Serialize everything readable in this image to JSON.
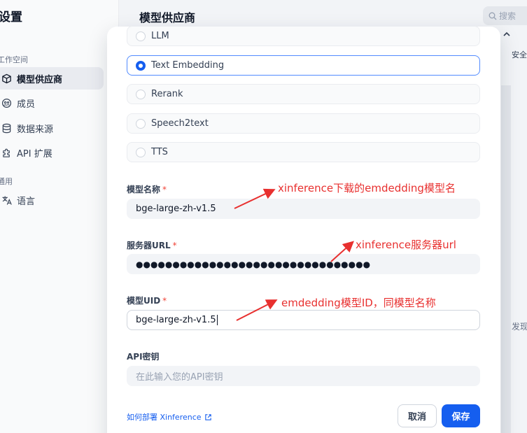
{
  "background": {
    "settings_title": "设置",
    "sections": {
      "workspace": "工作空间",
      "general": "通用"
    },
    "nav_items": [
      {
        "label": "模型供应商",
        "icon": "cube-icon",
        "active": true
      },
      {
        "label": "成员",
        "icon": "members-icon",
        "active": false
      },
      {
        "label": "数据来源",
        "icon": "database-icon",
        "active": false
      },
      {
        "label": "API 扩展",
        "icon": "puzzle-icon",
        "active": false
      },
      {
        "label": "语言",
        "icon": "translate-icon",
        "active": false
      }
    ],
    "page_title": "模型供应商",
    "search_placeholder": "搜索",
    "side_text_top": "安全配",
    "side_text_bottom": "发现"
  },
  "modal": {
    "model_types": [
      {
        "label": "LLM",
        "selected": false
      },
      {
        "label": "Text Embedding",
        "selected": true
      },
      {
        "label": "Rerank",
        "selected": false
      },
      {
        "label": "Speech2text",
        "selected": false
      },
      {
        "label": "TTS",
        "selected": false
      }
    ],
    "fields": {
      "model_name": {
        "label": "模型名称",
        "required": "*",
        "value": "bge-large-zh-v1.5"
      },
      "server_url": {
        "label": "服务器URL",
        "required": "*",
        "value": "●●●●●●●●●●●●●●●●●●●●●●●●●●●●●●●●"
      },
      "model_uid": {
        "label": "模型UID",
        "required": "*",
        "value": "bge-large-zh-v1.5"
      },
      "api_key": {
        "label": "API密钥",
        "placeholder": "在此输入您的API密钥"
      }
    },
    "help_link": "如何部署 Xinference",
    "cancel_label": "取消",
    "save_label": "保存"
  },
  "annotations": {
    "model_name_note": "xinference下载的emdedding模型名",
    "server_url_note": "xinference服务器url",
    "model_uid_note": "emdedding模型ID，同模型名称"
  },
  "colors": {
    "primary": "#155eef",
    "annotation": "#e8302f",
    "required": "#f04438"
  }
}
